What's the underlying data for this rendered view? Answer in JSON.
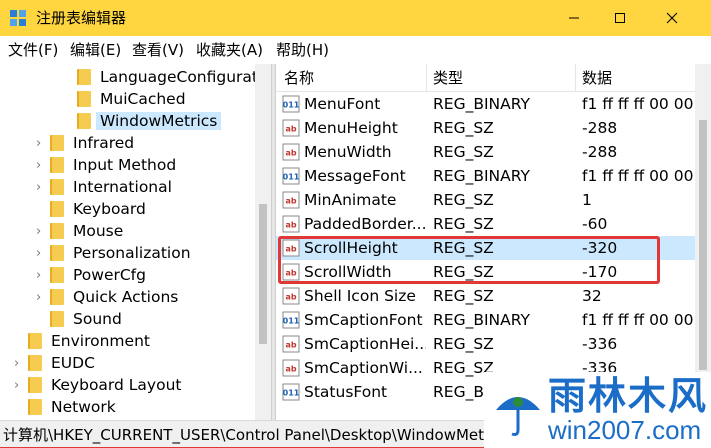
{
  "window": {
    "title": "注册表编辑器"
  },
  "menu": [
    "文件(F)",
    "编辑(E)",
    "查看(V)",
    "收藏夹(A)",
    "帮助(H)"
  ],
  "tree": [
    {
      "label": "LanguageConfiguratio",
      "level": 3,
      "expandable": false,
      "selected": false
    },
    {
      "label": "MuiCached",
      "level": 3,
      "expandable": false,
      "selected": false
    },
    {
      "label": "WindowMetrics",
      "level": 3,
      "expandable": false,
      "selected": true
    },
    {
      "label": "Infrared",
      "level": 2,
      "expandable": true,
      "selected": false
    },
    {
      "label": "Input Method",
      "level": 2,
      "expandable": true,
      "selected": false
    },
    {
      "label": "International",
      "level": 2,
      "expandable": true,
      "selected": false
    },
    {
      "label": "Keyboard",
      "level": 2,
      "expandable": false,
      "selected": false
    },
    {
      "label": "Mouse",
      "level": 2,
      "expandable": true,
      "selected": false
    },
    {
      "label": "Personalization",
      "level": 2,
      "expandable": true,
      "selected": false
    },
    {
      "label": "PowerCfg",
      "level": 2,
      "expandable": true,
      "selected": false
    },
    {
      "label": "Quick Actions",
      "level": 2,
      "expandable": true,
      "selected": false
    },
    {
      "label": "Sound",
      "level": 2,
      "expandable": false,
      "selected": false
    },
    {
      "label": "Environment",
      "level": 1,
      "expandable": false,
      "selected": false
    },
    {
      "label": "EUDC",
      "level": 1,
      "expandable": true,
      "selected": false
    },
    {
      "label": "Keyboard Layout",
      "level": 1,
      "expandable": true,
      "selected": false
    },
    {
      "label": "Network",
      "level": 1,
      "expandable": false,
      "selected": false
    }
  ],
  "columns": {
    "name": "名称",
    "type": "类型",
    "data": "数据"
  },
  "values": [
    {
      "name": "MenuFont",
      "type": "REG_BINARY",
      "data": "f1 ff ff ff 00 00 0",
      "icon": "binary-value-icon",
      "selected": false
    },
    {
      "name": "MenuHeight",
      "type": "REG_SZ",
      "data": "-288",
      "icon": "string-value-icon",
      "selected": false
    },
    {
      "name": "MenuWidth",
      "type": "REG_SZ",
      "data": "-288",
      "icon": "string-value-icon",
      "selected": false
    },
    {
      "name": "MessageFont",
      "type": "REG_BINARY",
      "data": "f1 ff ff ff 00 00 0",
      "icon": "binary-value-icon",
      "selected": false
    },
    {
      "name": "MinAnimate",
      "type": "REG_SZ",
      "data": "1",
      "icon": "string-value-icon",
      "selected": false
    },
    {
      "name": "PaddedBorder...",
      "type": "REG_SZ",
      "data": "-60",
      "icon": "string-value-icon",
      "selected": false
    },
    {
      "name": "ScrollHeight",
      "type": "REG_SZ",
      "data": "-320",
      "icon": "string-value-icon",
      "selected": true
    },
    {
      "name": "ScrollWidth",
      "type": "REG_SZ",
      "data": "-170",
      "icon": "string-value-icon",
      "selected": false
    },
    {
      "name": "Shell Icon Size",
      "type": "REG_SZ",
      "data": "32",
      "icon": "string-value-icon",
      "selected": false
    },
    {
      "name": "SmCaptionFont",
      "type": "REG_BINARY",
      "data": "f1 ff ff ff 00 00 0",
      "icon": "binary-value-icon",
      "selected": false
    },
    {
      "name": "SmCaptionHei...",
      "type": "REG_SZ",
      "data": "-336",
      "icon": "string-value-icon",
      "selected": false
    },
    {
      "name": "SmCaptionWi...",
      "type": "REG_SZ",
      "data": "-336",
      "icon": "string-value-icon",
      "selected": false
    },
    {
      "name": "StatusFont",
      "type": "REG_BI",
      "data": "",
      "icon": "binary-value-icon",
      "selected": false
    }
  ],
  "statusbar": {
    "path": "计算机\\HKEY_CURRENT_USER\\Control Panel\\Desktop\\WindowMet"
  },
  "watermark": {
    "title": "雨林木风",
    "url": "win2007.com"
  },
  "colors": {
    "titlebar": "#ffd640",
    "selection": "#cce8ff",
    "highlight": "#e03737",
    "watermark": "#1b6dc8"
  }
}
